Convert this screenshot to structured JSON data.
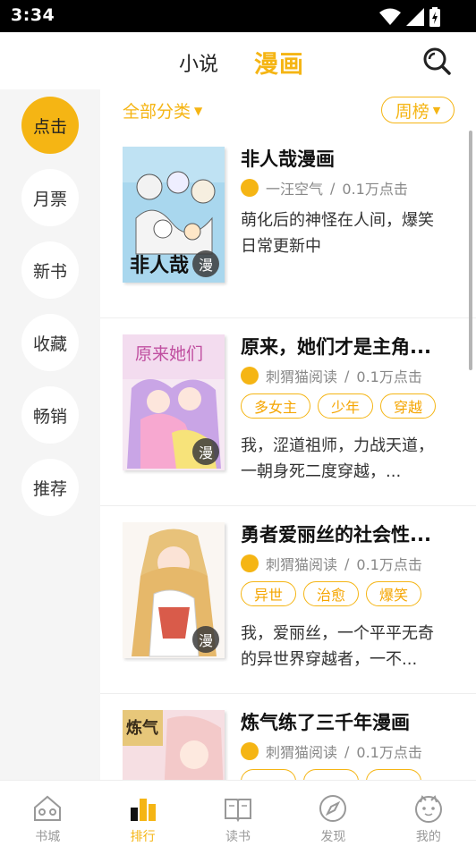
{
  "status_bar": {
    "time": "3:34"
  },
  "header": {
    "tabs": [
      {
        "label": "小说",
        "active": false
      },
      {
        "label": "漫画",
        "active": true
      }
    ],
    "search_icon": "search-icon"
  },
  "colors": {
    "accent": "#f5b514",
    "sidebar_bg": "#f5f5f5",
    "text_muted": "#888888"
  },
  "sidebar": {
    "items": [
      {
        "label": "点击",
        "active": true
      },
      {
        "label": "月票",
        "active": false
      },
      {
        "label": "新书",
        "active": false
      },
      {
        "label": "收藏",
        "active": false
      },
      {
        "label": "畅销",
        "active": false
      },
      {
        "label": "推荐",
        "active": false
      }
    ]
  },
  "filters": {
    "category": "全部分类",
    "rank": "周榜"
  },
  "books": [
    {
      "title": "非人哉漫画",
      "author": "一汪空气",
      "clicks": "0.1万点击",
      "tags": [],
      "description": "萌化后的神怪在人间，爆笑日常更新中",
      "badge": "漫",
      "cover_text": "非人哉"
    },
    {
      "title": "原来，她们才是主角...",
      "author": "刺猬猫阅读",
      "clicks": "0.1万点击",
      "tags": [
        "多女主",
        "少年",
        "穿越"
      ],
      "description": "我，涩道祖师，力战天道，一朝身死二度穿越，...",
      "badge": "漫",
      "cover_text": "原来她们"
    },
    {
      "title": "勇者爱丽丝的社会性...",
      "author": "刺猬猫阅读",
      "clicks": "0.1万点击",
      "tags": [
        "异世",
        "治愈",
        "爆笑"
      ],
      "description": "我，爱丽丝，一个平平无奇的异世界穿越者，一不...",
      "badge": "漫",
      "cover_text": ""
    },
    {
      "title": "炼气练了三千年漫画",
      "author": "刺猬猫阅读",
      "clicks": "0.1万点击",
      "tags": [
        "",
        "",
        ""
      ],
      "description": "",
      "badge": "",
      "cover_text": "炼气"
    }
  ],
  "bottom_nav": [
    {
      "label": "书城",
      "icon": "bookstore-icon",
      "active": false
    },
    {
      "label": "排行",
      "icon": "ranking-icon",
      "active": true
    },
    {
      "label": "读书",
      "icon": "book-icon",
      "active": false
    },
    {
      "label": "发现",
      "icon": "compass-icon",
      "active": false
    },
    {
      "label": "我的",
      "icon": "profile-cat-icon",
      "active": false
    }
  ]
}
